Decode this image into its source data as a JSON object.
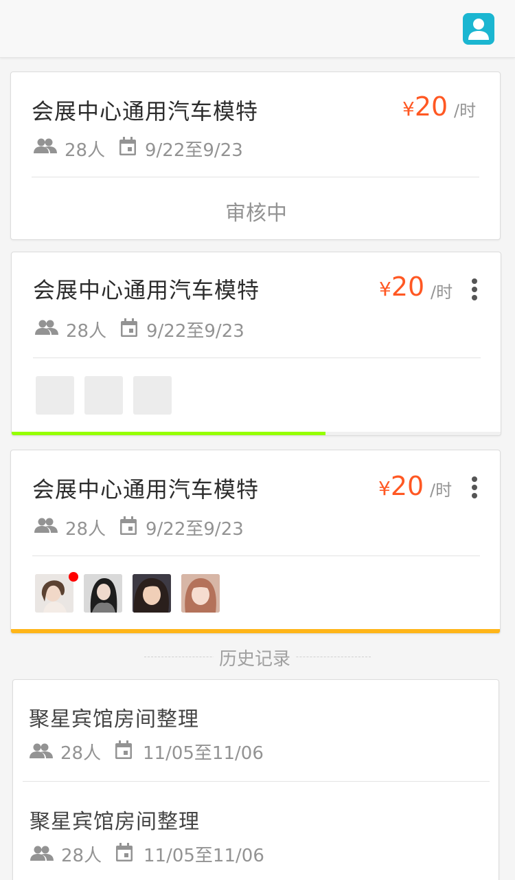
{
  "colors": {
    "title": "#2C2C2C",
    "meta": "#939393",
    "price": "#FF5823",
    "card_bg": "#FFFFFF",
    "progress_green": "#95FF00",
    "progress_orange": "#FFB518",
    "progress_track": "#F1F1F1",
    "badge_red": "#FF0000",
    "history_bg": "#F6F6F6",
    "history_label": "#A0A0A0"
  },
  "header": {
    "profile_icon": "user-icon"
  },
  "jobs": [
    {
      "title": "会展中心通用汽车模特",
      "people": "28人",
      "dates": "9/22至9/23",
      "price_symbol": "¥",
      "price": "20",
      "price_unit": "/时",
      "status": "审核中"
    },
    {
      "title": "会展中心通用汽车模特",
      "people": "28人",
      "dates": "9/22至9/23",
      "price_symbol": "¥",
      "price": "20",
      "price_unit": "/时",
      "progress": 0.64
    },
    {
      "title": "会展中心通用汽车模特",
      "people": "28人",
      "dates": "9/22至9/23",
      "price_symbol": "¥",
      "price": "20",
      "price_unit": "/时",
      "progress": 1.0
    }
  ],
  "history": {
    "label": "历史记录",
    "items": [
      {
        "title": "聚星宾馆房间整理",
        "people": "28人",
        "dates": "11/05至11/06"
      },
      {
        "title": "聚星宾馆房间整理",
        "people": "28人",
        "dates": "11/05至11/06"
      }
    ]
  }
}
